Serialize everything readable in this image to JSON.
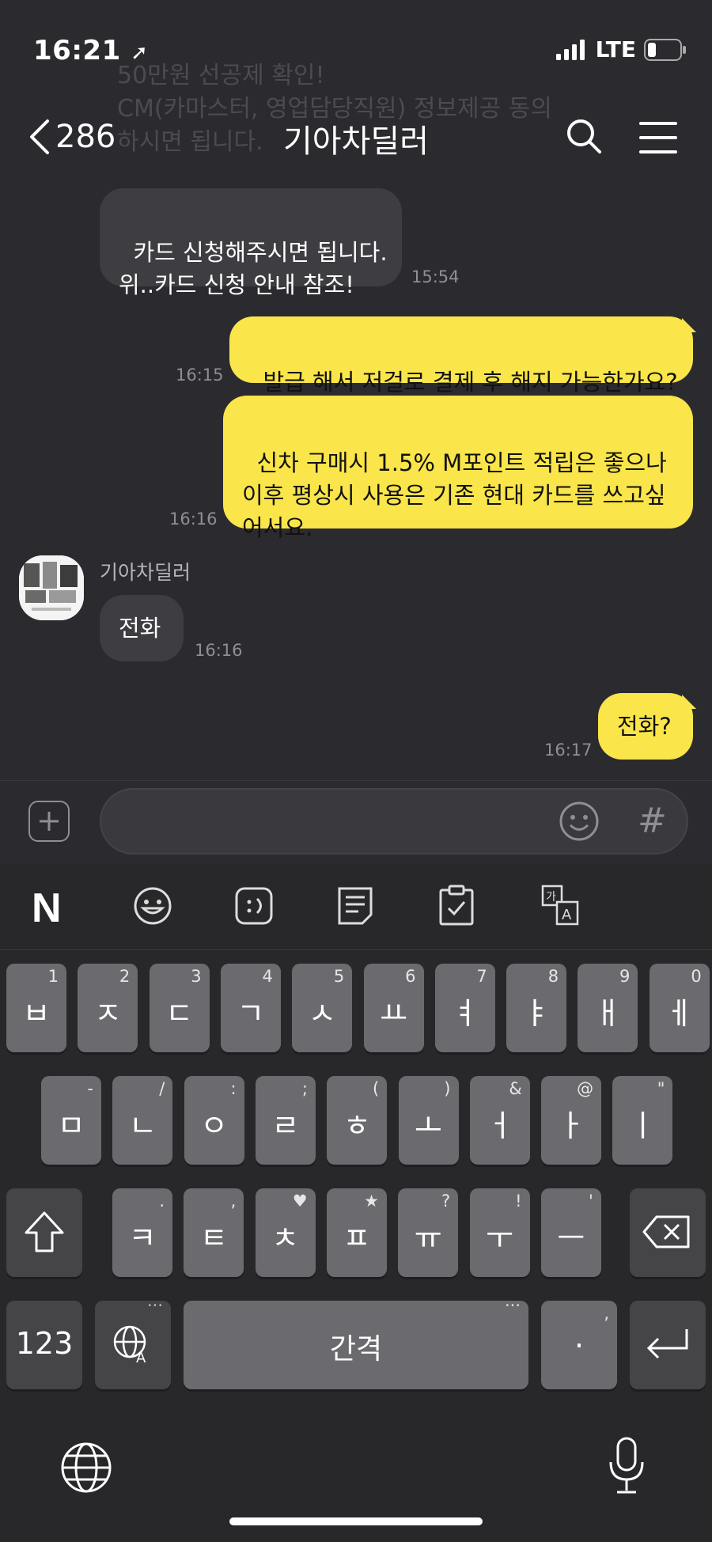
{
  "status": {
    "time": "16:21",
    "network": "LTE"
  },
  "background_text": "50만원 선공제 확인!\nCM(카마스터, 영업담당직원) 정보제공 동의\n하시면 됩니다.",
  "header": {
    "back_count": "286",
    "title": "기아차딜러"
  },
  "messages": [
    {
      "side": "received",
      "text": "카드 신청해주시면 됩니다.\n위..카드 신청 안내 참조!",
      "time": "15:54"
    },
    {
      "side": "sent",
      "text": "발급 해서 저걸로 결제 후 해지 가능한가요?",
      "time": "16:15"
    },
    {
      "side": "sent",
      "text": "신차 구매시 1.5% M포인트 적립은 좋으나\n이후 평상시 사용은 기존 현대 카드를 쓰고싶\n어서요.",
      "time": "16:16"
    },
    {
      "side": "received",
      "sender": "기아차딜러",
      "text": "전화",
      "time": "16:16"
    },
    {
      "side": "sent",
      "text": "전화?",
      "time": "16:17"
    }
  ],
  "input": {
    "value": "",
    "hash_label": "#"
  },
  "keyboard": {
    "toolbar": [
      "naver-n-icon",
      "emoji-icon",
      "emoticon-icon",
      "memo-icon",
      "clipboard-icon",
      "translate-icon"
    ],
    "toolbar_n": "N",
    "row1": [
      {
        "k": "ㅂ",
        "s": "1"
      },
      {
        "k": "ㅈ",
        "s": "2"
      },
      {
        "k": "ㄷ",
        "s": "3"
      },
      {
        "k": "ㄱ",
        "s": "4"
      },
      {
        "k": "ㅅ",
        "s": "5"
      },
      {
        "k": "ㅛ",
        "s": "6"
      },
      {
        "k": "ㅕ",
        "s": "7"
      },
      {
        "k": "ㅑ",
        "s": "8"
      },
      {
        "k": "ㅐ",
        "s": "9"
      },
      {
        "k": "ㅔ",
        "s": "0"
      }
    ],
    "row2": [
      {
        "k": "ㅁ",
        "s": "-"
      },
      {
        "k": "ㄴ",
        "s": "/"
      },
      {
        "k": "ㅇ",
        "s": ":"
      },
      {
        "k": "ㄹ",
        "s": ";"
      },
      {
        "k": "ㅎ",
        "s": "("
      },
      {
        "k": "ㅗ",
        "s": ")"
      },
      {
        "k": "ㅓ",
        "s": "&"
      },
      {
        "k": "ㅏ",
        "s": "@"
      },
      {
        "k": "ㅣ",
        "s": "\""
      }
    ],
    "row3": [
      {
        "k": "ㅋ",
        "s": "."
      },
      {
        "k": "ㅌ",
        "s": ","
      },
      {
        "k": "ㅊ",
        "s": "♥"
      },
      {
        "k": "ㅍ",
        "s": "★"
      },
      {
        "k": "ㅠ",
        "s": "?"
      },
      {
        "k": "ㅜ",
        "s": "!"
      },
      {
        "k": "ㅡ",
        "s": "'"
      }
    ],
    "numbers_label": "123",
    "space_label": "간격",
    "period_label": ".",
    "period_sub": ","
  }
}
